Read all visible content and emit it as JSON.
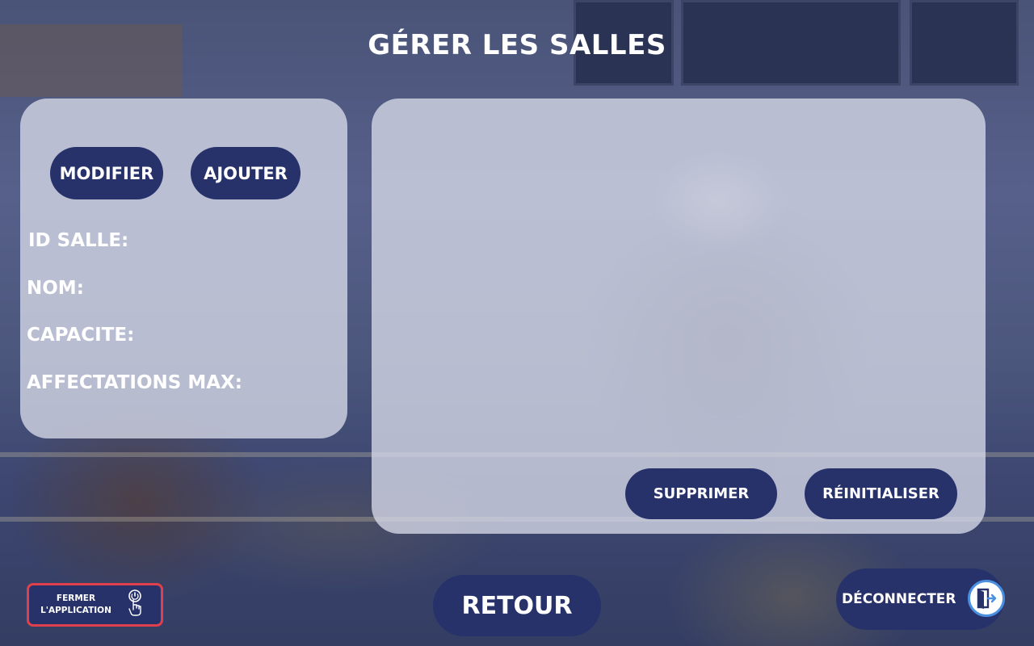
{
  "page": {
    "title": "GÉRER LES SALLES"
  },
  "form": {
    "modify_label": "MODIFIER",
    "add_label": "AJOUTER",
    "fields": {
      "id_label": "ID SALLE:",
      "name_label": "NOM:",
      "capacity_label": "CAPACITE:",
      "max_assign_label": "AFFECTATIONS MAX:"
    }
  },
  "list_panel": {
    "delete_label": "SUPPRIMER",
    "reset_label": "RÉINITIALISER"
  },
  "footer": {
    "close_app_line1": "FERMER",
    "close_app_line2": "L'APPLICATION",
    "back_label": "RETOUR",
    "logout_label": "DÉCONNECTER"
  },
  "colors": {
    "button": "#27326b",
    "panel": "#d7dae8",
    "close_border": "#e0404b",
    "logout_icon_border": "#4a8fe0"
  },
  "icons": {
    "close_app": "power-hand-icon",
    "logout": "door-exit-icon"
  }
}
